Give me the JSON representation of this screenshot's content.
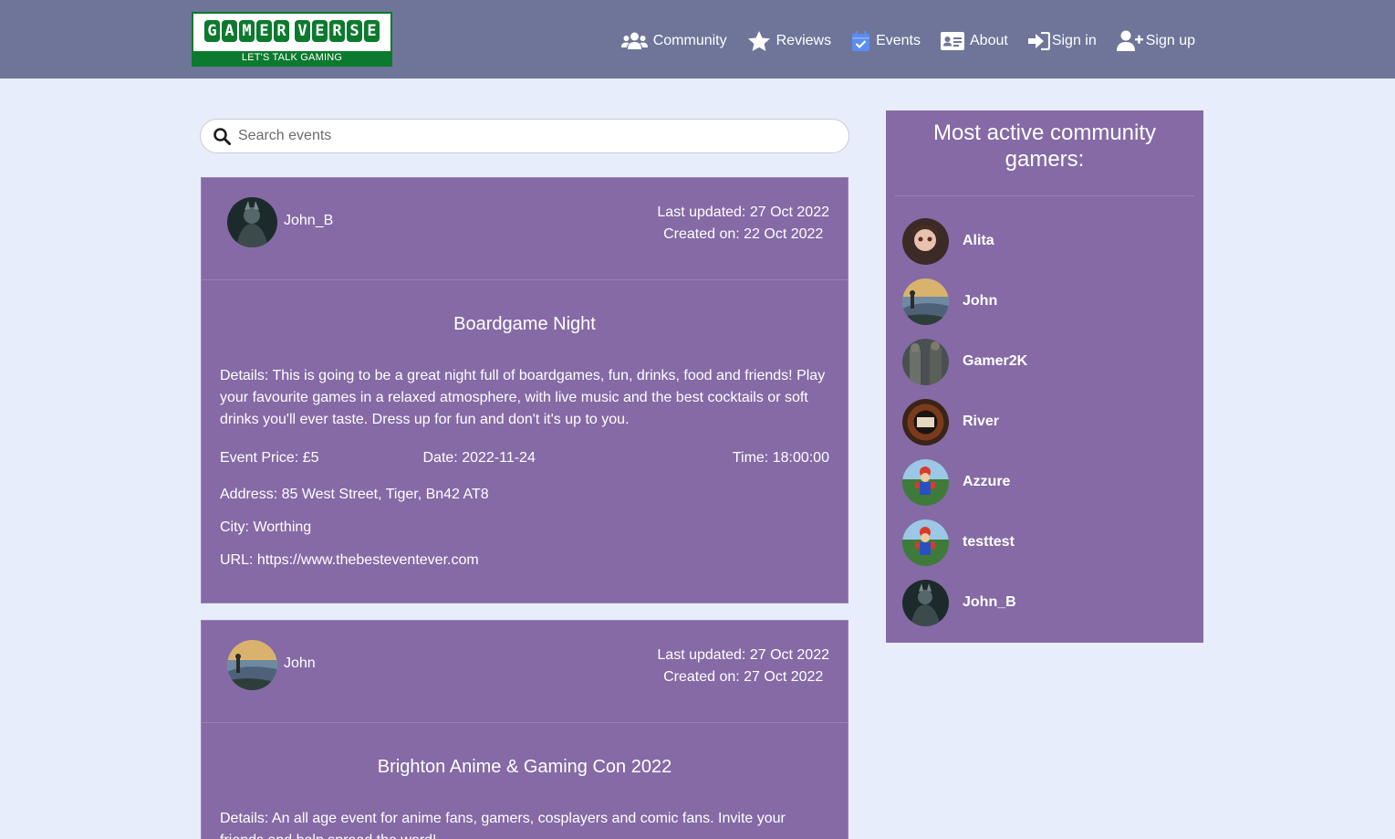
{
  "logo": {
    "title_letters": [
      "G",
      "A",
      "M",
      "E",
      "R",
      "V",
      "E",
      "R",
      "S",
      "E"
    ],
    "tagline": "LET'S TALK GAMING"
  },
  "nav": [
    {
      "label": "Community",
      "icon": "users-icon"
    },
    {
      "label": "Reviews",
      "icon": "star-icon"
    },
    {
      "label": "Events",
      "icon": "calendar-check-icon"
    },
    {
      "label": "About",
      "icon": "id-card-icon"
    },
    {
      "label": "Sign in",
      "icon": "sign-in-icon"
    },
    {
      "label": "Sign up",
      "icon": "user-plus-icon"
    }
  ],
  "search": {
    "placeholder": "Search events",
    "icon": "search-icon"
  },
  "events": [
    {
      "author": "John_B",
      "last_updated": "Last updated: 27 Oct 2022",
      "created_on": "Created on: 22 Oct 2022",
      "title": "Boardgame Night",
      "details": "Details: This is going to be a great night full of boardgames, fun, drinks, food and friends! Play your favourite games in a relaxed atmosphere, with live music and the best cocktails or soft drinks you'll ever taste. Dress up for fun and don't it's up to you.",
      "price": "Event Price: £5",
      "date": "Date: 2022-11-24",
      "time": "Time: 18:00:00",
      "address": "Address: 85 West Street, Tiger, Bn42 AT8",
      "city": "City: Worthing",
      "url": "URL: https://www.thebesteventever.com"
    },
    {
      "author": "John",
      "last_updated": "Last updated: 27 Oct 2022",
      "created_on": "Created on: 27 Oct 2022",
      "title": "Brighton Anime & Gaming Con 2022",
      "details": "Details: An all age event for anime fans, gamers, cosplayers and comic fans. Invite your friends and help spread the word!"
    }
  ],
  "sidebar": {
    "title": "Most active community gamers:",
    "gamers": [
      "Alita",
      "John",
      "Gamer2K",
      "River",
      "Azzure",
      "testtest",
      "John_B"
    ]
  },
  "colors": {
    "header": "#6e7599",
    "page_bg": "#e8edfb",
    "card": "#856aa6",
    "logo_green": "#0c7a2e",
    "events_icon_blue": "#5b8def"
  }
}
